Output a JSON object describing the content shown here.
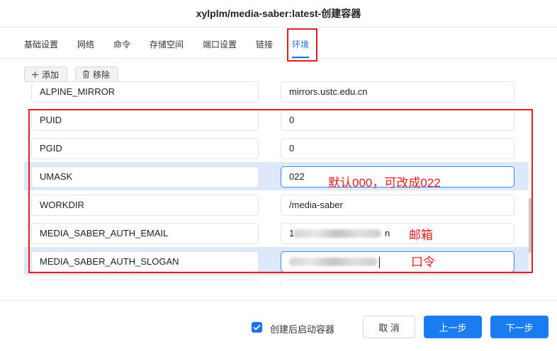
{
  "dialog": {
    "title": "xylplm/media-saber:latest-创建容器"
  },
  "tabs": [
    {
      "label": "基础设置"
    },
    {
      "label": "网络"
    },
    {
      "label": "命令"
    },
    {
      "label": "存储空间"
    },
    {
      "label": "端口设置"
    },
    {
      "label": "链接"
    },
    {
      "label": "环境",
      "active": true
    }
  ],
  "toolbar": {
    "add_label": "添加",
    "remove_label": "移除"
  },
  "env_rows": [
    {
      "key": "ALPINE_MIRROR",
      "value": "mirrors.ustc.edu.cn"
    },
    {
      "key": "PUID",
      "value": "0"
    },
    {
      "key": "PGID",
      "value": "0"
    },
    {
      "key": "UMASK",
      "value": "022"
    },
    {
      "key": "WORKDIR",
      "value": "/media-saber"
    },
    {
      "key": "MEDIA_SABER_AUTH_EMAIL",
      "value_visible_start": "1",
      "value_visible_end": "n"
    },
    {
      "key": "MEDIA_SABER_AUTH_SLOGAN",
      "value": ""
    }
  ],
  "annotations": {
    "umask_note": "默认000，可改成022",
    "email_note": "邮箱",
    "slogan_note": "口令"
  },
  "footer": {
    "autostart_label": "创建后启动容器",
    "autostart_checked": true,
    "cancel_label": "取 消",
    "prev_label": "上一步",
    "next_label": "下一步"
  },
  "colors": {
    "accent": "#1a73e8",
    "annotation": "#e02020",
    "row_highlight": "#dde9fb"
  }
}
